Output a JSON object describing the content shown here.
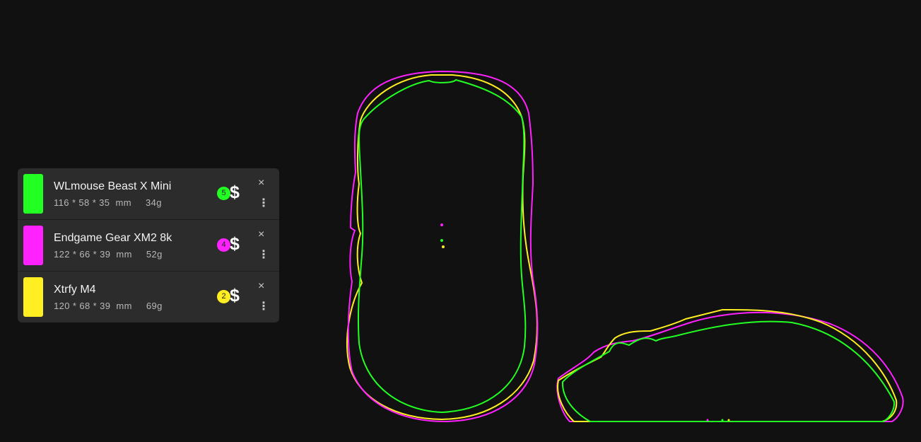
{
  "colors": {
    "green": "#22ff22",
    "magenta": "#ff22ff",
    "yellow": "#ffee22"
  },
  "mice": [
    {
      "name": "WLmouse Beast X Mini",
      "length": "116",
      "width": "58",
      "height": "35",
      "unit": "mm",
      "weight": "34g",
      "rank": "5",
      "price_icon": "$",
      "close_icon": "×",
      "more_icon": "⋮",
      "color": "#22ff22"
    },
    {
      "name": "Endgame Gear XM2 8k",
      "length": "122",
      "width": "66",
      "height": "39",
      "unit": "mm",
      "weight": "52g",
      "rank": "4",
      "price_icon": "$",
      "close_icon": "×",
      "more_icon": "⋮",
      "color": "#ff22ff"
    },
    {
      "name": "Xtrfy M4",
      "length": "120",
      "width": "68",
      "height": "39",
      "unit": "mm",
      "weight": "69g",
      "rank": "2",
      "price_icon": "$",
      "close_icon": "×",
      "more_icon": "⋮",
      "color": "#ffee22"
    }
  ]
}
